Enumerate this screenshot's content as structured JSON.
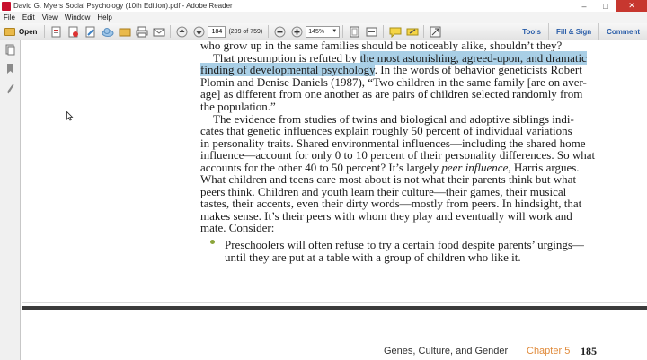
{
  "window": {
    "title": "David G. Myers Social Psychology (10th Edition).pdf - Adobe Reader",
    "buttons": [
      "–",
      "□",
      "✕"
    ]
  },
  "menu": [
    "File",
    "Edit",
    "View",
    "Window",
    "Help"
  ],
  "toolbar": {
    "open_label": "Open",
    "page_value": "184",
    "page_count": "(209 of 759)",
    "zoom_value": "145%",
    "right_links": [
      "Tools",
      "Fill & Sign",
      "Comment"
    ]
  },
  "left_nav_icons": [
    "pages-icon",
    "bookmarks-icon",
    "attachments-icon"
  ],
  "document": {
    "line1": "who grow up in the same families should be noticeably alike, shouldn’t they?",
    "line2_pre": "That presumption is refuted by ",
    "line2_hl": "the most astonishing, agreed-upon, and dramatic",
    "line3_hl": "finding of developmental psychology",
    "line3_post": ". In the words of behavior geneticists Robert",
    "line4": "Plomin and Denise Daniels (1987), “Two children in the same family [are on aver-",
    "line5": "age] as different from one another as are pairs of children selected randomly from",
    "line6": "the population.”",
    "para2": [
      "The evidence from studies of twins and biological and adoptive siblings indi-",
      "cates that genetic influences explain roughly 50 percent of individual variations",
      "in personality traits. Shared environmental influences—including the shared home",
      "influence—account for only 0 to 10 percent of their personality differences. So what"
    ],
    "line11_pre": "accounts for the other 40 to 50 percent? It’s largely ",
    "line11_em": "peer influence",
    "line11_post": ", Harris argues.",
    "para2b": [
      "What children and teens care most about is not what their parents think but what",
      "peers think. Children and youth learn their culture—their games, their musical",
      "tastes, their accents, even their dirty words—mostly from peers. In hindsight, that",
      "makes sense. It’s their peers with whom they play and eventually will work and"
    ],
    "line16": "mate. Consider:",
    "bullet1": "Preschoolers will often refuse to try a certain food despite parents’ urgings—",
    "bullet2": "until they are put at a table with a group of children who like it."
  },
  "footer": {
    "section": "Genes, Culture, and Gender",
    "chapter": "Chapter 5",
    "page": "185"
  },
  "colors": {
    "highlight": "#a9cfe6",
    "accent_link": "#2a5da8",
    "bullet": "#8ba53a",
    "chapter": "#e08a3a"
  }
}
